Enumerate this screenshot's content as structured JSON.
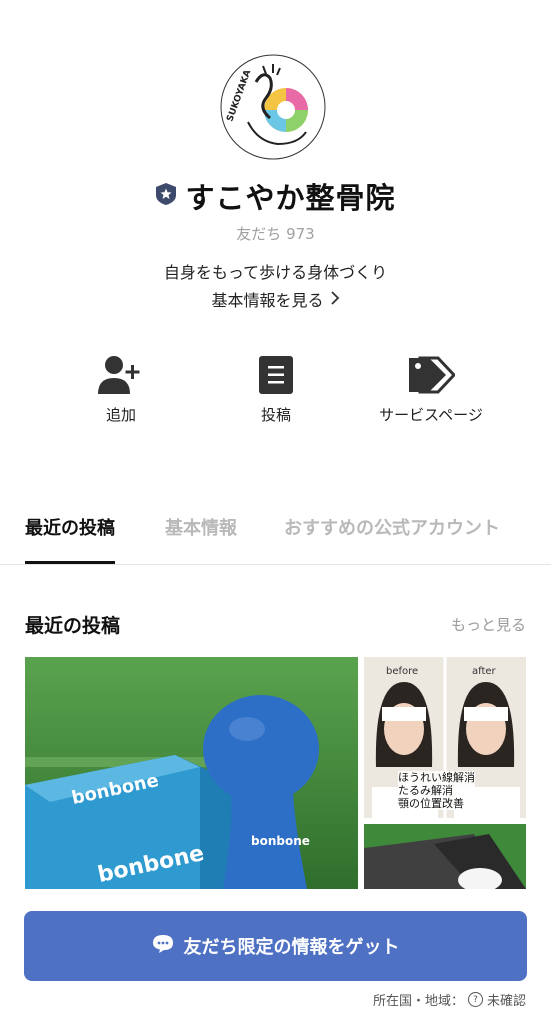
{
  "profile": {
    "logo_text": "SUKOYAKA",
    "name": "すこやか整骨院",
    "friends_label": "友だち 973",
    "tagline": "自身をもって歩ける身体づくり",
    "basic_info_link": "基本情報を見る"
  },
  "actions": [
    {
      "label": "追加",
      "icon": "add-friend-icon"
    },
    {
      "label": "投稿",
      "icon": "post-icon"
    },
    {
      "label": "サービスページ",
      "icon": "tag-icon"
    }
  ],
  "tabs": [
    {
      "label": "最近の投稿",
      "active": true
    },
    {
      "label": "基本情報",
      "active": false
    },
    {
      "label": "おすすめの公式アカウント",
      "active": false
    }
  ],
  "recent": {
    "title": "最近の投稿",
    "more_label": "もっと見る",
    "post1": {
      "brand": "bonbone",
      "brand2": "bonbone",
      "brand3": "bonbone"
    },
    "post2": {
      "before": "before",
      "after": "after",
      "caption1": "ほうれい線解消",
      "caption2": "たるみ解消",
      "caption3": "顎の位置改善"
    }
  },
  "cta": {
    "label": "友だち限定の情報をゲット",
    "icon": "chat-bubble-icon"
  },
  "footer": {
    "label": "所在国・地域：",
    "value": "未確認"
  },
  "colors": {
    "accent": "#4f71c4",
    "badge": "#3d4a6b"
  }
}
